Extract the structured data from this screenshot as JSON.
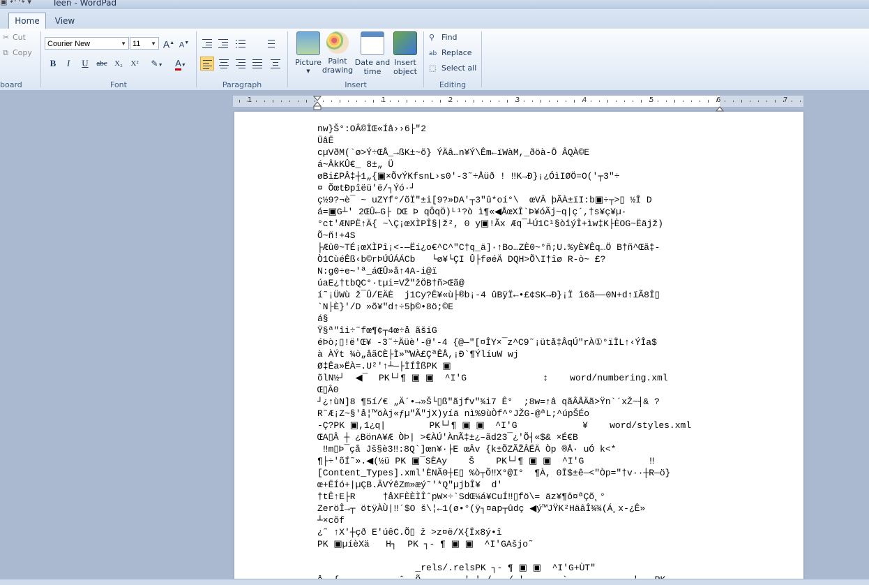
{
  "window": {
    "title": "Teen - WordPad"
  },
  "tabs": [
    "Home",
    "View"
  ],
  "clipboard": {
    "cut": "Cut",
    "copy": "Copy",
    "label": "board"
  },
  "font": {
    "family": "Courier New",
    "size": "11",
    "bold": "B",
    "italic": "I",
    "underline": "U",
    "strike": "abc",
    "subscript": "X₂",
    "superscript": "X²",
    "grow": "A",
    "shrink": "A",
    "color_glyph": "A",
    "label": "Font"
  },
  "paragraph": {
    "label": "Paragraph"
  },
  "insert": {
    "picture": "Picture",
    "paint_drawing": [
      "Paint",
      "drawing"
    ],
    "date_time": [
      "Date and",
      "time"
    ],
    "insert_object": [
      "Insert",
      "object"
    ],
    "label": "Insert"
  },
  "editing": {
    "find": "Find",
    "replace": "Replace",
    "select_all": "Select all",
    "label": "Editing"
  },
  "ruler": {
    "numbers": [
      "1",
      "1",
      "2",
      "3",
      "4",
      "5",
      "6",
      "7"
    ]
  },
  "icons": {
    "cut": "scissors-icon",
    "copy": "copy-icon",
    "find": "binoculars-icon",
    "replace": "replace-icon",
    "select_all": "select-all-icon",
    "picture": "picture-icon",
    "paint": "palette-icon",
    "date_time": "calendar-clock-icon",
    "object": "object-icon"
  },
  "colors": {
    "ribbon_bg": "#e6eef8",
    "accent": "#fbd77a",
    "workspace": "#abb9d0",
    "font_color": "#cc0000"
  },
  "document": {
    "lines": [
      "nw}Š°:OÂ©ÎŒ«Íâ››6├\"2",
      "ÜâË",
      "cµVðM(`ø>Ý÷ŒÅ_→ßK±~õ} ÝÄâ…n¥Ý\\Êm←ïWàM,_ðöà-Ö ÂQÀ©E",
      "á~ÂkKÛ€_ 8±„ Ü",
      "øBi£PÂ‡┼1„{▣×ÕvÝKfsnL›s0'-3˜÷Åüð ! ‼K→Ð}¡¿ÓìIØÖ=O('┬3\"÷",
      "¤ ÕœtÐpîëü'ë/┐Ýó·┘",
      "ç½9?¬è¯ ~ uZYf°/õÏ\"±i[9?»DA'┬3\"û*oí°\\  œVÂ þÃÀ±ïI:b▣÷┬>▯ ½Î D",
      "á=▣G┴' 2ŒÛ←G├ DŒ Þ qÔqÖ)ᴸ¹?ò ì¶«◀ÅœXÎ`Þ¥óÃj~q|ç´,†s¥ç¥µ·",
      "°ct'ÆNPË↑Ä{ ~\\Ç¡œXÌPÎ§|ž², 0 y▣!Ãx Æq¯┴Ú1C¹§òîýÎ+ìw‡K├ÈOG~Ëäjž)",
      "Õ~ñ!+4S",
      "├Æû0~TÉ¡œXÌPî¡<-—Ëí¿o€^C^\"C†q_ä]·↑Bo…ZÈ0~°ñ;U.%yÈ¥Êq…Ö B†ñ^Œã‡-",
      "Ò1CùéÊß‹b©rÞÚÚÁÁCb   └ø¥└ÇI Û├føéÄ DQH>Õ\\I†îø R-ò~ £?",
      "N:g0÷e~'ª_áŒÛ»å↑4A-i@ï",
      "úaE¿†tbQC°·tµi=VŽ\"žÖB†ñ>Œã@",
      "í˜¡ÜWù ž¯Û/EÄÈ  j1Cy?Ê¥«ù├®b¡-4 ûBÿÏ←•£¢SK→Ð}¡Ï î6ã——0N+d↑ïÃ8Î▯",
      "`N├È}'/D »õ¥\"d↑÷5þ©•8ö;©E",
      "á§",
      "Ÿ§ª\"îi÷˜fœ¶¢┬4œ÷å ãšiG",
      "éÞò;▯!ë'Œ¥ -3˜÷Äüè'-@'-4 {@—\"[¤ÎY×¯z^C9˜¡ütå‡ÂqÚ\"rÀ①°ïÏL↑‹ÝÎa$",
      "à ÀÝt ¾ò„åãCÈ├Ì»™WÀ£ÇªÊÅ,¡Ð`¶ÝlíuW wj",
      "Ø‡Êa»ËÀ=.U²'↑┴—├ÌÍÎßPK ▣",
      "õlN½┘  ◀¯  PK└┘¶ ▣ ▣  ^I'G              ↕    word/numbering.xml",
      "Œ▯Â0",
      "┘¿↑ùN]8 ¶5í/€ „Ä´•→»Š└▯ß\"ãjfv\"¾i7 Ê°  ;8w=↑â qãÂÅÄã>Ÿn`´xŽ~┤& ?",
      "R˜Æ¡Z~§'å¦™öÀj«ƒµ\"Ã\"jX)yíä nì%9ùÒf^°JŽG-@ªL;^úpŠÉo",
      "-Ç?PK ▣,1¿q|        PK└┘¶ ▣ ▣  ^I'G            ¥    word/styles.xml",
      "ŒA▯Â ┼ ¿BönA¥Æ ÒÞ| >€ÀÚ'ÀnÃ‡±¿–ãd23¯¿'Õ┤«$& ×É€B",
      " ‼m▯Þ¯çå Jš§è3‼:8Q`]œn¥·├E œÂv {k±ÕZÃŽÂËÄ Òp ®Å· uÓ k<*",
      "¶├÷'õÍ˜».◀(½ü PK ▣¯SÈAy    Š    PK└┘¶ ▣ ▣  ^I'G            ‼",
      "[Content_Types].xml'ÈNÃ0┼E▯ %ò┬Õ‼X°@I°  ¶À, 0Î$±ê—<\"Òp=\"†v··┼R—ö}",
      "œ+ËÍó+|µÇB.ÂVÝêZm»æý˜'*Q\"µjbÎ¥  d'",
      "†tÊ↑E├R     †åXFÈÈÌÎˆpW×÷`SdŒ¼á¥CuÍ‼▯fö\\= äz¥¶ô¤ªÇõ¸°",
      "ZeröÎ→┬ ötÿÀÙ|‼´$O š\\¦←1(ø•°(ÿ┐¤ap┬ûdç ◀ý™JŸK²HäâÎ¾¾(Á¸x-¿Ê»",
      "┴×cõf",
      "¿˜ ↑X'┼çð E'úêC.Õ▯ ž >z¤ë/X{Ïx8ý•î",
      "PK ▣µíèXä   H┐  PK ┐- ¶ ▣ ▣  ^I'GAšjo˜",
      "",
      "                  _rels/.relsPK ┐- ¶ ▣ ▣  ^I'G+ÙT\"",
      "å  {           ˆ  Õ        ' ' /   / '       `            '   PK"
    ]
  }
}
